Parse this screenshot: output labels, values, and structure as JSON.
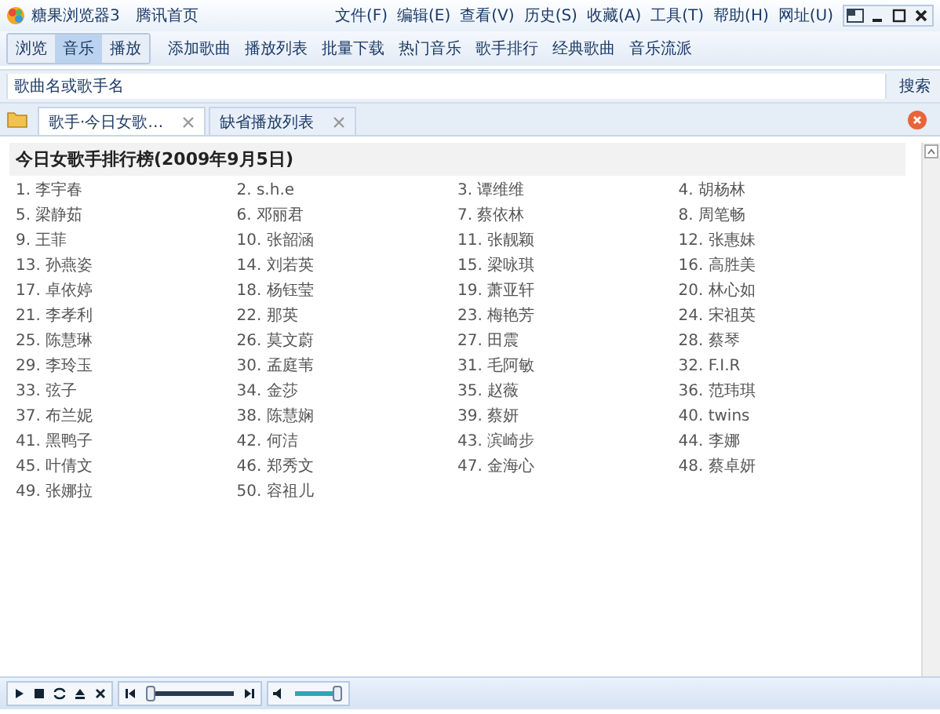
{
  "window": {
    "title": "糖果浏览器3",
    "home_link": "腾讯首页"
  },
  "menu": [
    "文件(F)",
    "编辑(E)",
    "查看(V)",
    "历史(S)",
    "收藏(A)",
    "工具(T)",
    "帮助(H)",
    "网址(U)"
  ],
  "modes": [
    {
      "label": "浏览",
      "selected": false
    },
    {
      "label": "音乐",
      "selected": true
    },
    {
      "label": "播放",
      "selected": false
    }
  ],
  "toolbar": [
    "添加歌曲",
    "播放列表",
    "批量下载",
    "热门音乐",
    "歌手排行",
    "经典歌曲",
    "音乐流派"
  ],
  "search": {
    "placeholder": "歌曲名或歌手名",
    "button": "搜索"
  },
  "tabs": [
    {
      "label": "歌手·今日女歌…",
      "selected": true
    },
    {
      "label": "缺省播放列表",
      "selected": false
    }
  ],
  "chart": {
    "title": "今日女歌手排行榜(2009年9月5日)",
    "items": [
      "1. 李宇春",
      "2. s.h.e",
      "3. 谭维维",
      "4. 胡杨林",
      "5. 梁静茹",
      "6. 邓丽君",
      "7. 蔡依林",
      "8. 周笔畅",
      "9. 王菲",
      "10. 张韶涵",
      "11. 张靓颖",
      "12. 张惠妹",
      "13. 孙燕姿",
      "14. 刘若英",
      "15. 梁咏琪",
      "16. 高胜美",
      "17. 卓依婷",
      "18. 杨钰莹",
      "19. 萧亚轩",
      "20. 林心如",
      "21. 李孝利",
      "22. 那英",
      "23. 梅艳芳",
      "24. 宋祖英",
      "25. 陈慧琳",
      "26. 莫文蔚",
      "27. 田震",
      "28. 蔡琴",
      "29. 李玲玉",
      "30. 孟庭苇",
      "31. 毛阿敏",
      "32. F.I.R",
      "33. 弦子",
      "34. 金莎",
      "35. 赵薇",
      "36. 范玮琪",
      "37. 布兰妮",
      "38. 陈慧娴",
      "39. 蔡妍",
      "40. twins",
      "41. 黑鸭子",
      "42. 何洁",
      "43. 滨崎步",
      "44. 李娜",
      "45. 叶倩文",
      "46. 郑秀文",
      "47. 金海心",
      "48. 蔡卓妍",
      "49. 张娜拉",
      "50. 容祖儿"
    ]
  },
  "player": {
    "seek": {
      "level": 0.0
    },
    "volume": {
      "level": 1.0
    }
  }
}
